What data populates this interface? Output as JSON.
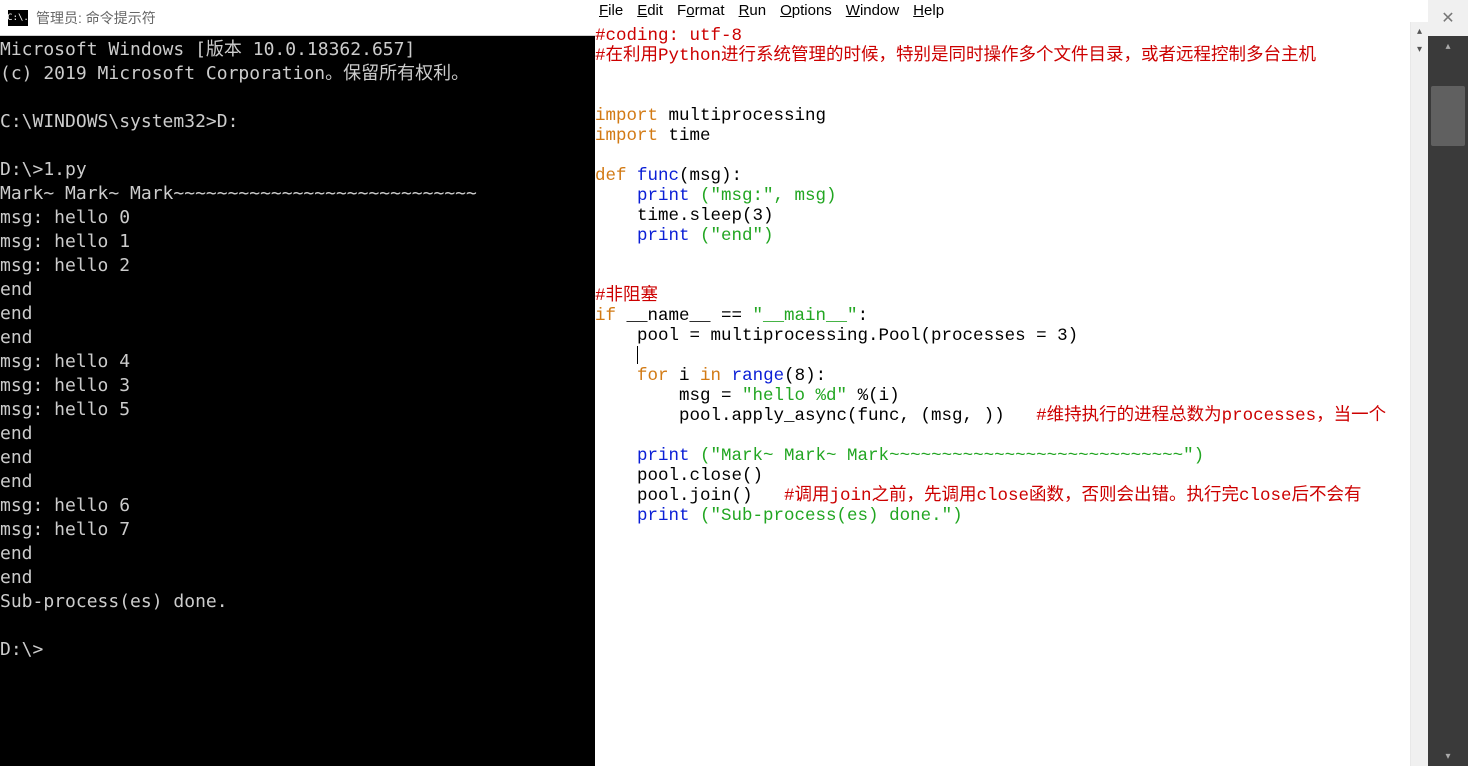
{
  "cmd": {
    "title": "管理员: 命令提示符",
    "icon_text": "C:\\.",
    "lines": [
      "Microsoft Windows [版本 10.0.18362.657]",
      "(c) 2019 Microsoft Corporation。保留所有权利。",
      "",
      "C:\\WINDOWS\\system32>D:",
      "",
      "D:\\>1.py",
      "Mark~ Mark~ Mark~~~~~~~~~~~~~~~~~~~~~~~~~~~~",
      "msg: hello 0",
      "msg: hello 1",
      "msg: hello 2",
      "end",
      "end",
      "end",
      "msg: hello 4",
      "msg: hello 3",
      "msg: hello 5",
      "end",
      "end",
      "end",
      "msg: hello 6",
      "msg: hello 7",
      "end",
      "end",
      "Sub-process(es) done.",
      "",
      "D:\\>"
    ]
  },
  "editor": {
    "menus": {
      "file": "File",
      "edit": "Edit",
      "format": "Format",
      "format_pre": "F",
      "format_ul": "o",
      "format_post": "rmat",
      "run": "Run",
      "options": "Options",
      "window": "Window",
      "help": "Help"
    },
    "code": {
      "l1": "#coding: utf-8",
      "l2": "#在利用Python进行系统管理的时候，特别是同时操作多个文件目录，或者远程控制多台主机",
      "imp": "import",
      "mp": " multiprocessing",
      "time": " time",
      "def": "def",
      "func": " func",
      "msg_param": "(msg):",
      "print": "print",
      "str_msg": " (\"msg:\", msg)",
      "sleep": "    time.sleep(3)",
      "str_end": " (\"end\")",
      "cmt_nb": "#非阻塞",
      "if": "if",
      "name": " __name__ == ",
      "str_main": "\"__main__\"",
      "colon": ":",
      "pool_line": "    pool = multiprocessing.Pool(processes = 3)",
      "for": "for",
      "i_in": " i ",
      "in": "in",
      "range": " range",
      "r8": "(8):",
      "msg_eq": "        msg = ",
      "str_hello": "\"hello %d\"",
      "pcti": " %(i)",
      "apply": "        pool.apply_async(func, (msg, ))   ",
      "cmt_apply": "#维持执行的进程总数为processes，当一个",
      "str_mark": " (\"Mark~ Mark~ Mark~~~~~~~~~~~~~~~~~~~~~~~~~~~~\")",
      "close": "    pool.close()",
      "join": "    pool.join()   ",
      "cmt_join": "#调用join之前，先调用close函数，否则会出错。执行完close后不会有",
      "str_done": " (\"Sub-process(es) done.\")"
    }
  },
  "right": {
    "close_glyph": "✕",
    "up": "▴",
    "down": "▾"
  }
}
